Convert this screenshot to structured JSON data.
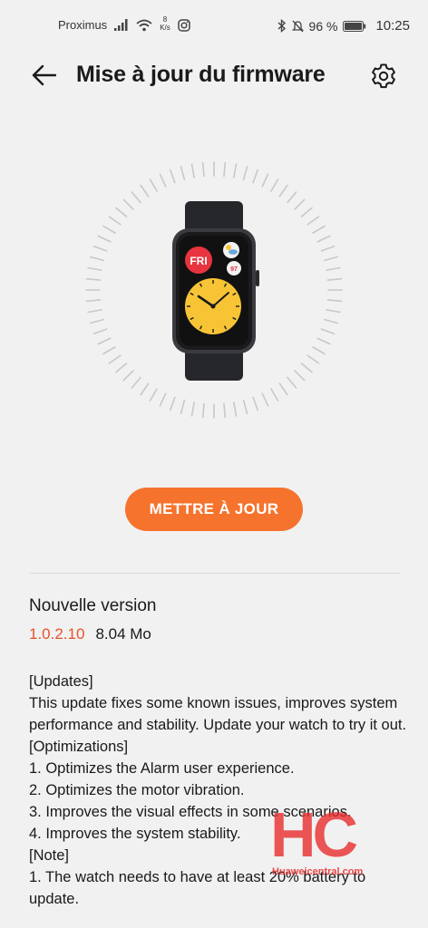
{
  "status_bar": {
    "carrier": "Proximus",
    "net_speed_value": "8",
    "net_speed_unit": "K/s",
    "battery": "96 %",
    "time": "10:25"
  },
  "header": {
    "title": "Mise à jour du firmware"
  },
  "watch_face": {
    "day": "FRI",
    "small_label": "97",
    "accent_colors": {
      "day_badge": "#e7343f",
      "dial": "#f7c436"
    }
  },
  "actions": {
    "update_label": "METTRE À JOUR",
    "accent": "#f5732d"
  },
  "version": {
    "heading": "Nouvelle version",
    "number": "1.0.2.10",
    "size": "8.04 Mo"
  },
  "release_notes": [
    "[Updates]",
    "This update fixes some known issues, improves system performance and stability. Update your watch to try it out.",
    "[Optimizations]",
    "1. Optimizes the Alarm user experience.",
    "2. Optimizes the motor vibration.",
    "3. Improves the visual effects in some scenarios.",
    "4. Improves the system stability.",
    "[Note]",
    "1. The watch needs to have at least 20% battery to update."
  ],
  "watermark": {
    "letters": "HC",
    "site": "Huaweicentral.com"
  }
}
